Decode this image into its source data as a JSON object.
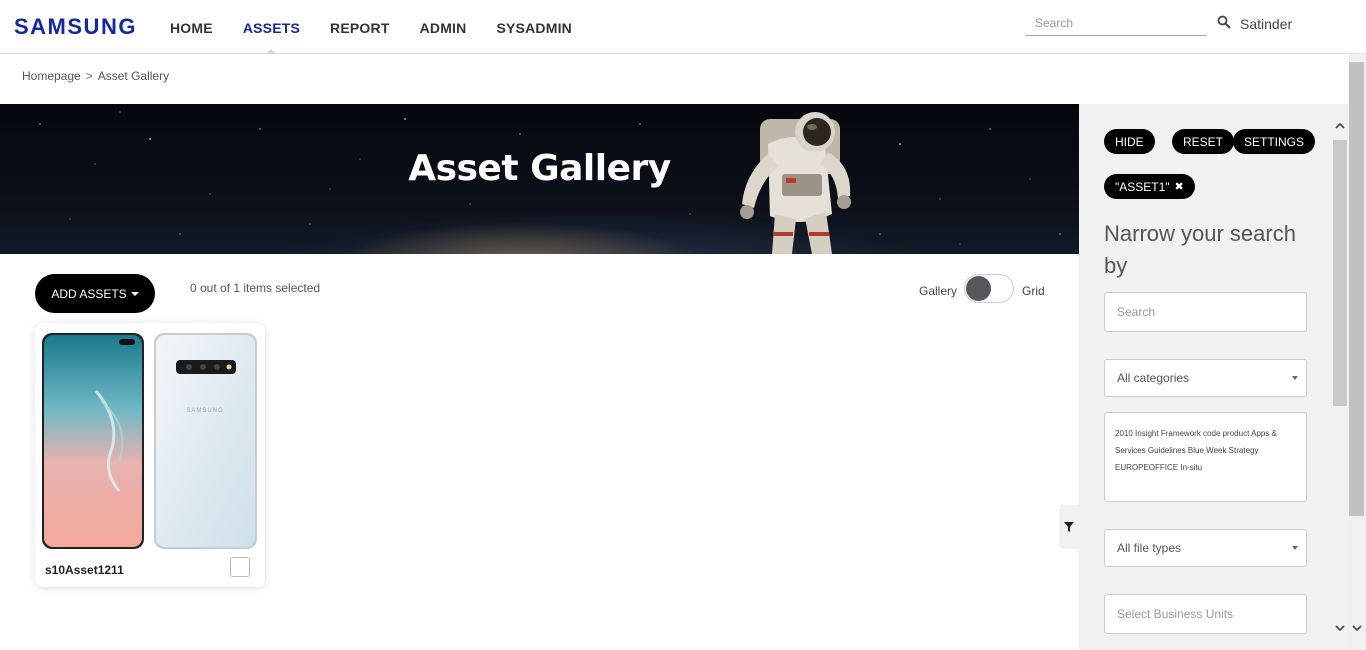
{
  "header": {
    "logo": "SAMSUNG",
    "nav": [
      {
        "label": "HOME",
        "active": false
      },
      {
        "label": "ASSETS",
        "active": true
      },
      {
        "label": "REPORT",
        "active": false
      },
      {
        "label": "ADMIN",
        "active": false
      },
      {
        "label": "SYSADMIN",
        "active": false
      }
    ],
    "search_placeholder": "Search",
    "username": "Satinder"
  },
  "breadcrumb": {
    "home": "Homepage",
    "separator": ">",
    "current": "Asset Gallery"
  },
  "banner": {
    "title": "Asset Gallery"
  },
  "toolbar": {
    "add_assets_label": "ADD ASSETS",
    "selected_text": "0 out of 1 items selected",
    "view_gallery_label": "Gallery",
    "view_grid_label": "Grid"
  },
  "assets": [
    {
      "name": "s10Asset1211",
      "brand_text": "SAMSUNG",
      "checked": false
    }
  ],
  "sidebar": {
    "hide_label": "HIDE",
    "reset_label": "RESET",
    "settings_label": "SETTINGS",
    "active_filter": "\"ASSET1\"",
    "narrow_title": "Narrow your search by",
    "search_placeholder": "Search",
    "category_value": "All categories",
    "tags_text": "2010 Insight Framework code product Apps & Services Guidelines Blue Week Strategy EUROPEOFFICE In-situ",
    "file_type_value": "All file types",
    "business_units_placeholder": "Select Business Units"
  },
  "colors": {
    "brand": "#1428a0",
    "pill_bg": "#000000",
    "sidebar_bg": "#f1f1f1"
  }
}
